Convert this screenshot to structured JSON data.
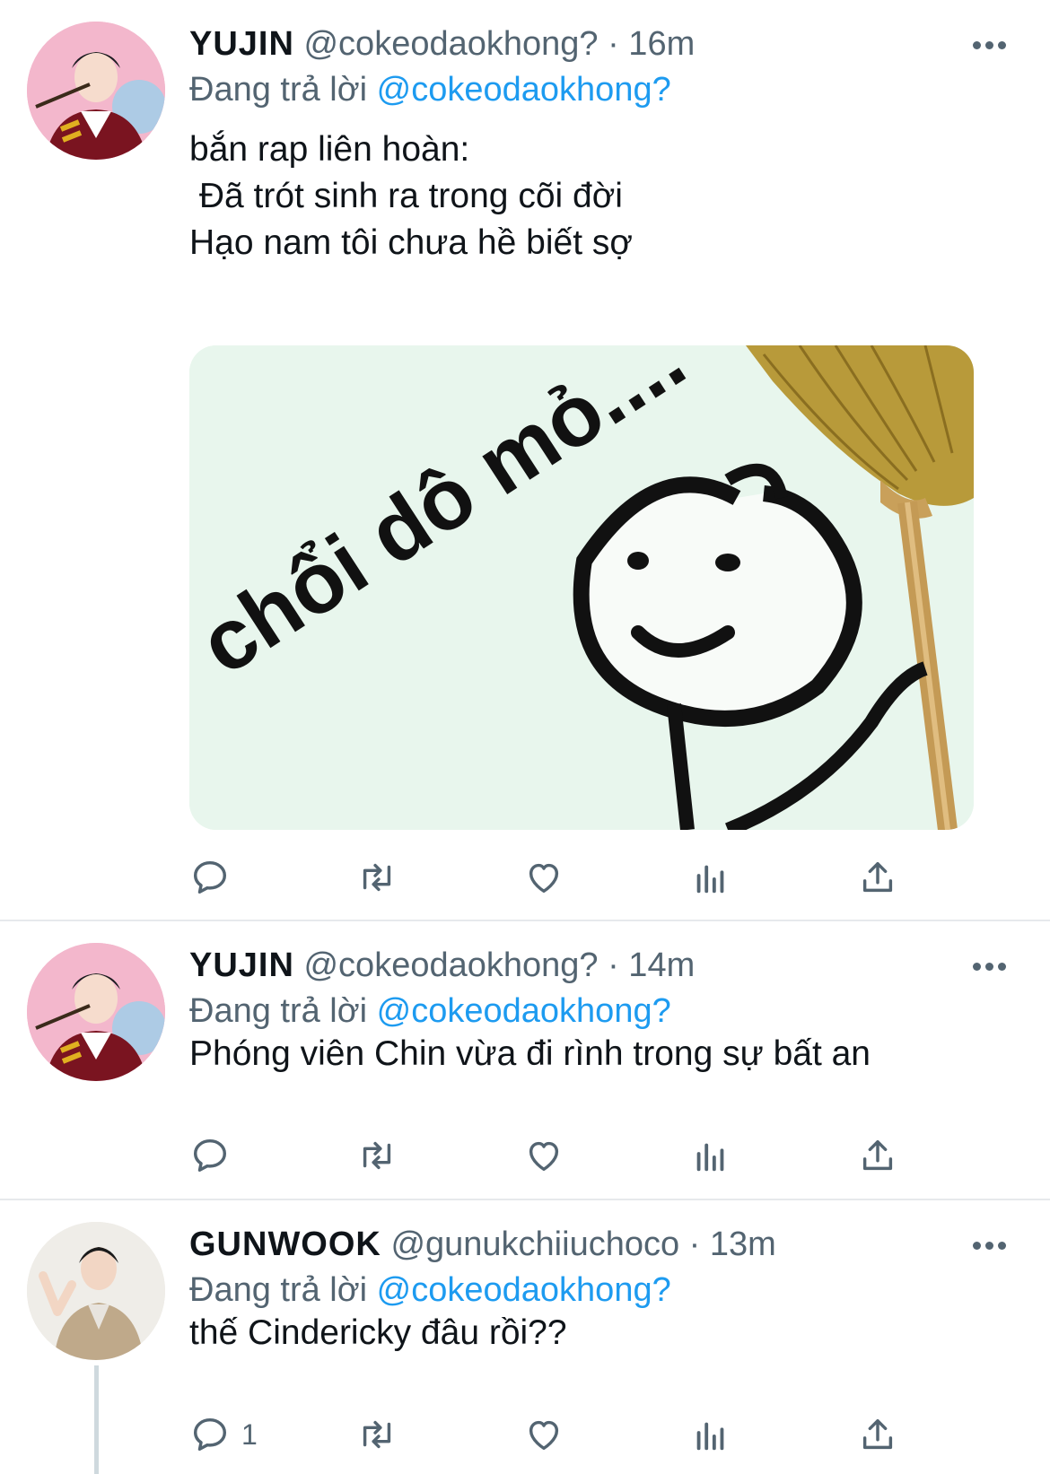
{
  "tweets": [
    {
      "name": "YUJIN",
      "handle": "@cokeodaokhong?",
      "time": "· 16m",
      "reply_prefix": "Đang trả lời",
      "reply_to": "@cokeodaokhong?",
      "text": "bắn rap liên hoàn:\n Đã trót sinh ra trong cõi đời\nHạo nam tôi chưa hề biết sợ",
      "has_media": true,
      "media_caption": "chổi dô mỏ....",
      "reply_count": ""
    },
    {
      "name": "YUJIN",
      "handle": "@cokeodaokhong?",
      "time": "· 14m",
      "reply_prefix": "Đang trả lời",
      "reply_to": "@cokeodaokhong?",
      "text": "Phóng viên Chin vừa đi rình trong sự bất an",
      "has_media": false,
      "reply_count": ""
    },
    {
      "name": "GUNWOOK",
      "handle": "@gunukchiiuchoco",
      "time": "· 13m",
      "reply_prefix": "Đang trả lời",
      "reply_to": "@cokeodaokhong?",
      "text": "thế Cindericky đâu rồi??",
      "has_media": false,
      "reply_count": "1"
    }
  ],
  "icons": [
    "reply-icon",
    "retweet-icon",
    "like-icon",
    "analytics-icon",
    "share-icon",
    "more-icon"
  ],
  "colors": {
    "mention": "#1d9bf0",
    "secondary_text": "#536471",
    "primary_text": "#0f1419",
    "divider": "#e6e9ec"
  }
}
